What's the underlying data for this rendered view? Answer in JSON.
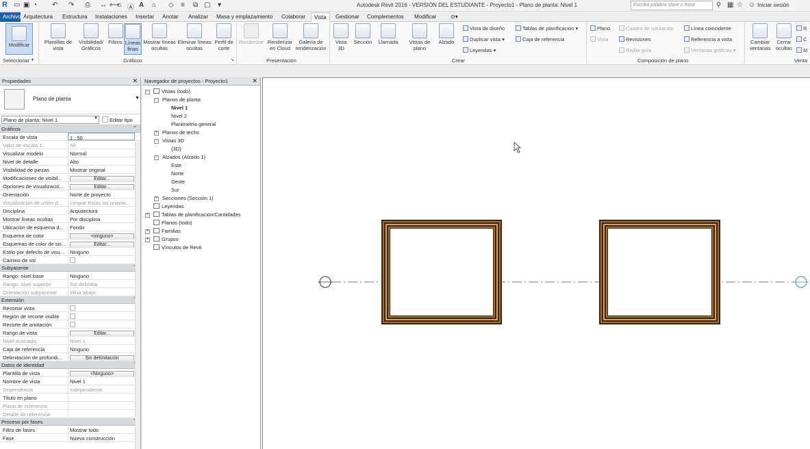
{
  "titlebar": {
    "title": "Autodesk Revit 2016 - VERSIÓN DEL ESTUDIANTE -    Proyecto1 - Plano de planta: Nivel 1",
    "search_placeholder": "Escriba palabra clave o frase",
    "signin_label": "Iniciar sesión"
  },
  "tabs": [
    {
      "label": "Archivo"
    },
    {
      "label": "Arquitectura"
    },
    {
      "label": "Estructura"
    },
    {
      "label": "Instalaciones"
    },
    {
      "label": "Insertar"
    },
    {
      "label": "Anotar"
    },
    {
      "label": "Analizar"
    },
    {
      "label": "Masa y emplazamiento"
    },
    {
      "label": "Colaborar"
    },
    {
      "label": "Vista"
    },
    {
      "label": "Gestionar"
    },
    {
      "label": "Complementos"
    },
    {
      "label": "Modificar"
    }
  ],
  "ribbon": {
    "modify_label": "Modificar",
    "select_panel_label": "Seleccionar",
    "graphics": {
      "panel_label": "Gráficos",
      "buttons": [
        {
          "label": "Plantillas de vista"
        },
        {
          "label": "Visibilidad/ Gráficos"
        },
        {
          "label": "Filtros"
        },
        {
          "label": "Líneas finas"
        },
        {
          "label": "Mostrar líneas ocultas"
        },
        {
          "label": "Eliminar líneas ocultas"
        },
        {
          "label": "Perfil de corte"
        }
      ]
    },
    "presentation": {
      "panel_label": "Presentación",
      "buttons": [
        {
          "label": "Renderizar"
        },
        {
          "label": "Renderizar en Cloud"
        },
        {
          "label": "Galería de renderización"
        }
      ]
    },
    "create": {
      "panel_label": "Crear",
      "buttons": [
        {
          "label": "Vista 3D"
        },
        {
          "label": "Sección"
        },
        {
          "label": "Llamada"
        },
        {
          "label": "Vistas de plano"
        },
        {
          "label": "Alzado"
        }
      ],
      "small": [
        {
          "label": "Vista de diseño"
        },
        {
          "label": "Duplicar vista"
        },
        {
          "label": "Leyendas"
        },
        {
          "label": "Tablas de planificación"
        },
        {
          "label": "Caja de referencia"
        }
      ]
    },
    "sheet": {
      "panel_label": "Composición de plano",
      "small": [
        {
          "label": "Plano"
        },
        {
          "label": "Vista"
        },
        {
          "label": "Cuadro de rotulación"
        },
        {
          "label": "Revisiones"
        },
        {
          "label": "Rejilla guía"
        },
        {
          "label": "Línea coincidente"
        },
        {
          "label": "Referencia a vista"
        },
        {
          "label": "Ventanas gráficas"
        }
      ]
    },
    "windows": {
      "panel_label": "Venta",
      "buttons": [
        {
          "label": "Cambiar ventanas"
        },
        {
          "label": "Cerrar ocultas"
        }
      ],
      "small": [
        {
          "label": "R"
        },
        {
          "label": "C"
        },
        {
          "label": "M"
        }
      ]
    }
  },
  "properties": {
    "header": "Propiedades",
    "type_name": "Plano de planta",
    "view_selector": "Plano de planta: Nivel 1",
    "edit_type": "Editar tipo",
    "sections": [
      {
        "title": "Gráficos",
        "rows": [
          {
            "k": "Escala de vista",
            "v": "1 : 50",
            "kind": "input"
          },
          {
            "k": "Valor de escala    1:",
            "v": "50",
            "kind": "dis"
          },
          {
            "k": "Visualizar modelo",
            "v": "Normal"
          },
          {
            "k": "Nivel de detalle",
            "v": "Alto"
          },
          {
            "k": "Visibilidad de piezas",
            "v": "Mostrar original"
          },
          {
            "k": "Modificaciones de visibil...",
            "v": "Editar...",
            "kind": "btn"
          },
          {
            "k": "Opciones de visualizació...",
            "v": "Editar...",
            "kind": "btn"
          },
          {
            "k": "Orientación",
            "v": "Norte de proyecto"
          },
          {
            "k": "Visualización de unión d...",
            "v": "Limpiar todas las unione...",
            "kind": "dis"
          },
          {
            "k": "Disciplina",
            "v": "Arquitectura"
          },
          {
            "k": "Mostrar líneas ocultas",
            "v": "Por disciplina"
          },
          {
            "k": "Ubicación de esquema d...",
            "v": "Fondo"
          },
          {
            "k": "Esquema de color",
            "v": "<ninguno>",
            "kind": "btn"
          },
          {
            "k": "Esquemas de color de sis...",
            "v": "Editar...",
            "kind": "btn"
          },
          {
            "k": "Estilo por defecto de visu...",
            "v": "Ninguno"
          },
          {
            "k": "Camino de sol",
            "v": "",
            "kind": "chk"
          }
        ]
      },
      {
        "title": "Subyacente",
        "rows": [
          {
            "k": "Rango: nivel base",
            "v": "Ninguno"
          },
          {
            "k": "Rango: nivel superior",
            "v": "Sin delimitar",
            "kind": "dis"
          },
          {
            "k": "Orientación subyacente",
            "v": "Mirar abajo",
            "kind": "dis"
          }
        ]
      },
      {
        "title": "Extensión",
        "rows": [
          {
            "k": "Recortar vista",
            "v": "",
            "kind": "chk"
          },
          {
            "k": "Región de recorte visible",
            "v": "",
            "kind": "chk"
          },
          {
            "k": "Recorte de anotación",
            "v": "",
            "kind": "chk"
          },
          {
            "k": "Rango de vista",
            "v": "Editar...",
            "kind": "btn"
          },
          {
            "k": "Nivel asociado",
            "v": "Nivel 1",
            "kind": "dis"
          },
          {
            "k": "Caja de referencia",
            "v": "Ninguno"
          },
          {
            "k": "Delimitación de profundi...",
            "v": "Sin delimitación",
            "kind": "btn"
          }
        ]
      },
      {
        "title": "Datos de identidad",
        "rows": [
          {
            "k": "Plantilla de vista",
            "v": "<Ninguno>",
            "kind": "btn"
          },
          {
            "k": "Nombre de vista",
            "v": "Nivel 1"
          },
          {
            "k": "Dependencia",
            "v": "Independiente",
            "kind": "dis"
          },
          {
            "k": "Título en plano",
            "v": ""
          },
          {
            "k": "Plano de referencia",
            "v": "",
            "kind": "dis"
          },
          {
            "k": "Detalle de referencia",
            "v": "",
            "kind": "dis"
          }
        ]
      },
      {
        "title": "Proceso por fases",
        "rows": [
          {
            "k": "Filtro de fases",
            "v": "Mostrar todo"
          },
          {
            "k": "Fase",
            "v": "Nueva construcción"
          }
        ]
      }
    ]
  },
  "browser": {
    "header": "Navegador de proyectos - Proyecto1",
    "items": [
      {
        "label": "Vistas (todo)",
        "level": 0,
        "tog": "-",
        "icon": true
      },
      {
        "label": "Planos de planta",
        "level": 1,
        "tog": "-"
      },
      {
        "label": "Nivel 1",
        "level": 2,
        "bold": true
      },
      {
        "label": "Nivel 2",
        "level": 2
      },
      {
        "label": "Planimetría general",
        "level": 2
      },
      {
        "label": "Planos de techo",
        "level": 1,
        "tog": "+"
      },
      {
        "label": "Vistas 3D",
        "level": 1,
        "tog": "-"
      },
      {
        "label": "{3D}",
        "level": 2
      },
      {
        "label": "Alzados (Alzado 1)",
        "level": 1,
        "tog": "-"
      },
      {
        "label": "Este",
        "level": 2
      },
      {
        "label": "Norte",
        "level": 2
      },
      {
        "label": "Oeste",
        "level": 2
      },
      {
        "label": "Sur",
        "level": 2
      },
      {
        "label": "Secciones (Sección 1)",
        "level": 1,
        "tog": "+"
      },
      {
        "label": "Leyendas",
        "level": 0,
        "icon": true
      },
      {
        "label": "Tablas de planificación/Cantidades",
        "level": 0,
        "tog": "+",
        "icon": true
      },
      {
        "label": "Planos (todo)",
        "level": 0,
        "icon": true
      },
      {
        "label": "Familias",
        "level": 0,
        "tog": "+",
        "icon": true
      },
      {
        "label": "Grupos",
        "level": 0,
        "tog": "+",
        "icon": true
      },
      {
        "label": "Vínculos de Revit",
        "level": 0,
        "icon": true
      }
    ]
  },
  "colors": {
    "wall_outer": "#3a2414",
    "wall_mid": "#a86f2c",
    "wall_light": "#d9a45a",
    "gridline": "#7b7b7b",
    "grid_bubble_right": "#3a7fd0"
  }
}
